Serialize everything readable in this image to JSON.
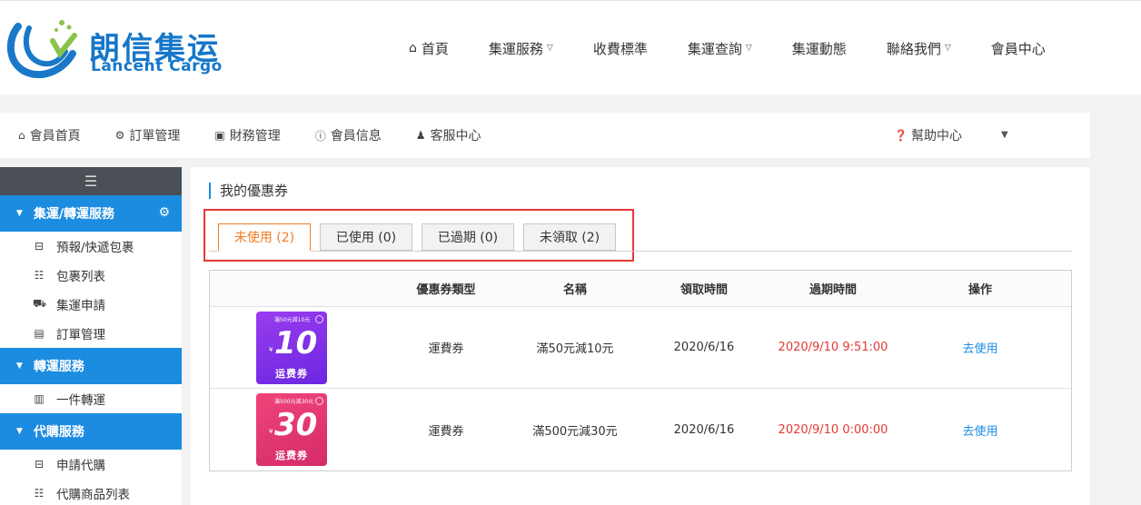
{
  "header": {
    "logo_cn": "朗信集运",
    "logo_en": "Lancent Cargo",
    "nav": [
      {
        "label": "首頁",
        "icon": "home-icon",
        "has_caret": false
      },
      {
        "label": "集運服務",
        "has_caret": true
      },
      {
        "label": "收費標準",
        "has_caret": false
      },
      {
        "label": "集運查詢",
        "has_caret": true
      },
      {
        "label": "集運動態",
        "has_caret": false
      },
      {
        "label": "聯絡我們",
        "has_caret": true
      },
      {
        "label": "會員中心",
        "has_caret": false
      }
    ]
  },
  "member_nav": {
    "items": [
      {
        "label": "會員首頁",
        "icon": "home-icon"
      },
      {
        "label": "訂單管理",
        "icon": "gear-icon"
      },
      {
        "label": "財務管理",
        "icon": "money-icon"
      },
      {
        "label": "會員信息",
        "icon": "info-icon"
      },
      {
        "label": "客服中心",
        "icon": "user-icon"
      }
    ],
    "help_label": "幫助中心"
  },
  "sidebar": {
    "sections": [
      {
        "title": "集運/轉運服務",
        "items": [
          {
            "label": "預報/快遞包裹",
            "icon": "inbox-icon"
          },
          {
            "label": "包裹列表",
            "icon": "list-icon"
          },
          {
            "label": "集運申請",
            "icon": "truck-icon"
          },
          {
            "label": "訂單管理",
            "icon": "book-icon"
          }
        ]
      },
      {
        "title": "轉運服務",
        "items": [
          {
            "label": "一件轉運",
            "icon": "chart-icon"
          }
        ]
      },
      {
        "title": "代購服務",
        "items": [
          {
            "label": "申請代購",
            "icon": "inbox-icon"
          },
          {
            "label": "代購商品列表",
            "icon": "list-icon"
          }
        ]
      }
    ]
  },
  "main": {
    "title": "我的優惠券",
    "tabs": [
      {
        "label": "未使用 (2)",
        "active": true
      },
      {
        "label": "已使用 (0)",
        "active": false
      },
      {
        "label": "已過期 (0)",
        "active": false
      },
      {
        "label": "未領取 (2)",
        "active": false
      }
    ],
    "table": {
      "headers": [
        "",
        "優惠券類型",
        "名稱",
        "領取時間",
        "過期時間",
        "操作"
      ],
      "rows": [
        {
          "coupon": {
            "condition": "滿50元減10元",
            "yen": "¥",
            "amount": "10",
            "label": "运费券",
            "color": "#7a2fe8"
          },
          "type": "運費券",
          "name": "滿50元減10元",
          "received": "2020/6/16",
          "expires": "2020/9/10 9:51:00",
          "action": "去使用"
        },
        {
          "coupon": {
            "condition": "滿500元減30元",
            "yen": "¥",
            "amount": "30",
            "label": "运费券",
            "color": "#e0356f"
          },
          "type": "運費券",
          "name": "滿500元減30元",
          "received": "2020/6/16",
          "expires": "2020/9/10 0:00:00",
          "action": "去使用"
        }
      ]
    }
  }
}
